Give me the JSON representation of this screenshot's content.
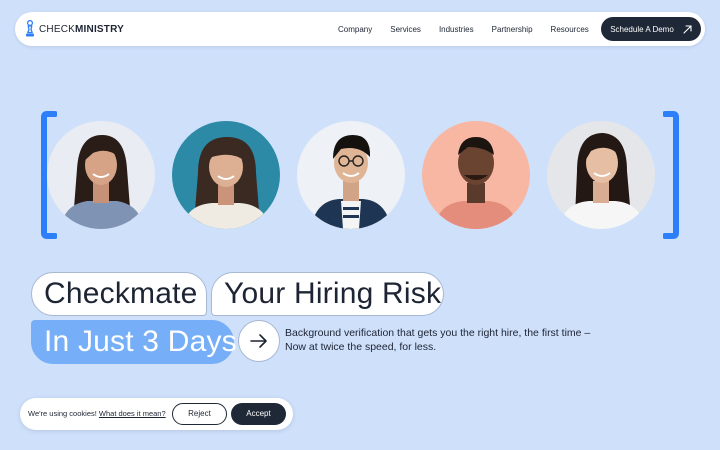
{
  "brand": {
    "name_light": "CHECK",
    "name_bold": "MINISTRY",
    "icon": "chess-pawn-icon",
    "color": "#2d7ff9"
  },
  "nav": {
    "links": [
      "Company",
      "Services",
      "Industries",
      "Partnership",
      "Resources"
    ],
    "cta_label": "Schedule A Demo",
    "cta_icon": "arrow-up-right-icon"
  },
  "hero": {
    "headline_line1_a": "Checkmate",
    "headline_line1_b": "Your Hiring Risk",
    "headline_line2": "In Just 3 Days",
    "arrow_icon": "arrow-right-icon",
    "tagline_line1": "Background verification that gets you the right hire, the first time –",
    "tagline_line2": "Now at twice the speed, for less."
  },
  "portraits": [
    {
      "name": "portrait-woman-long-hair",
      "bg": "#e9ecf3"
    },
    {
      "name": "portrait-woman-teal-background",
      "bg": "#2c8aa6"
    },
    {
      "name": "portrait-man-glasses",
      "bg": "#eef1f6"
    },
    {
      "name": "portrait-man-pink-background",
      "bg": "#f7b7a3"
    },
    {
      "name": "portrait-woman-white-shirt",
      "bg": "#e4e6ea"
    }
  ],
  "cookie": {
    "message": "We're using cookies!",
    "link_text": "What does it mean?",
    "reject_label": "Reject",
    "accept_label": "Accept"
  },
  "colors": {
    "background": "#cfe0fb",
    "dark": "#1e2836",
    "accent_blue": "#2d7ff9",
    "pill_blue": "#76aef7"
  }
}
